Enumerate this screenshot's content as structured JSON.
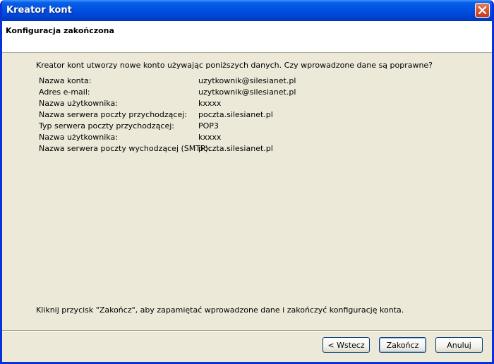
{
  "window": {
    "title": "Kreator kont"
  },
  "header": {
    "title": "Konfiguracja zakończona"
  },
  "content": {
    "intro": "Kreator kont utworzy nowe konto używając poniższych danych. Czy wprowadzone dane są poprawne?",
    "summary": [
      {
        "label": "Nazwa konta:",
        "value": "uzytkownik@silesianet.pl"
      },
      {
        "label": "Adres e-mail:",
        "value": "uzytkownik@silesianet.pl"
      },
      {
        "label": "Nazwa użytkownika:",
        "value": "kxxxx"
      },
      {
        "label": "Nazwa serwera poczty przychodzącej:",
        "value": "poczta.silesianet.pl"
      },
      {
        "label": "Typ serwera poczty przychodzącej:",
        "value": "POP3"
      },
      {
        "label": "Nazwa użytkownika:",
        "value": "kxxxx"
      },
      {
        "label": "Nazwa serwera poczty wychodzącej (SMTP):",
        "value": "poczta.silesianet.pl"
      }
    ],
    "footer": "Kliknij przycisk \"Zakończ\", aby zapamiętać wprowadzone dane i zakończyć konfigurację konta."
  },
  "buttons": {
    "back_label": "< Wstecz",
    "finish_label": "Zakończ",
    "cancel_label": "Anuluj"
  },
  "icons": {
    "close": "close-icon"
  },
  "colors": {
    "titlebar": "#0054E3",
    "dialog_bg": "#ECE9D8",
    "close_button": "#D85B3C"
  }
}
